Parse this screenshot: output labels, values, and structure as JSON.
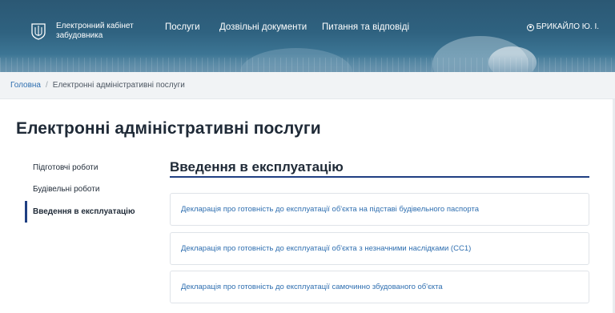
{
  "header": {
    "brand_line1": "Електронний кабінет",
    "brand_line2": "забудовника",
    "nav": [
      "Послуги",
      "Дозвільні документи",
      "Питання та відповіді"
    ],
    "user_name": "БРИКАЙЛО Ю. І."
  },
  "breadcrumb": {
    "home": "Головна",
    "separator": "/",
    "current": "Електронні адміністративні послуги"
  },
  "page": {
    "title": "Електронні адміністративні послуги"
  },
  "sidebar": {
    "items": [
      {
        "label": "Підготовчі роботи",
        "active": false
      },
      {
        "label": "Будівельні роботи",
        "active": false
      },
      {
        "label": "Введення в експлуатацію",
        "active": true
      }
    ]
  },
  "section": {
    "title": "Введення в експлуатацію",
    "links": [
      "Декларація про готовність до експлуатації об'єкта на підставі будівельного паспорта",
      "Декларація про готовність до експлуатації об'єкта з незначними наслідками (СС1)",
      "Декларація про готовність до експлуатації самочинно збудованого об'єкта"
    ]
  },
  "colors": {
    "header": "#2f6280",
    "link": "#2f6fb0",
    "accent": "#1f3f82",
    "breadcrumb_bg": "#f1f3f5"
  },
  "icons": {
    "logo": "trident-emblem-icon",
    "user": "user-circle-icon"
  }
}
